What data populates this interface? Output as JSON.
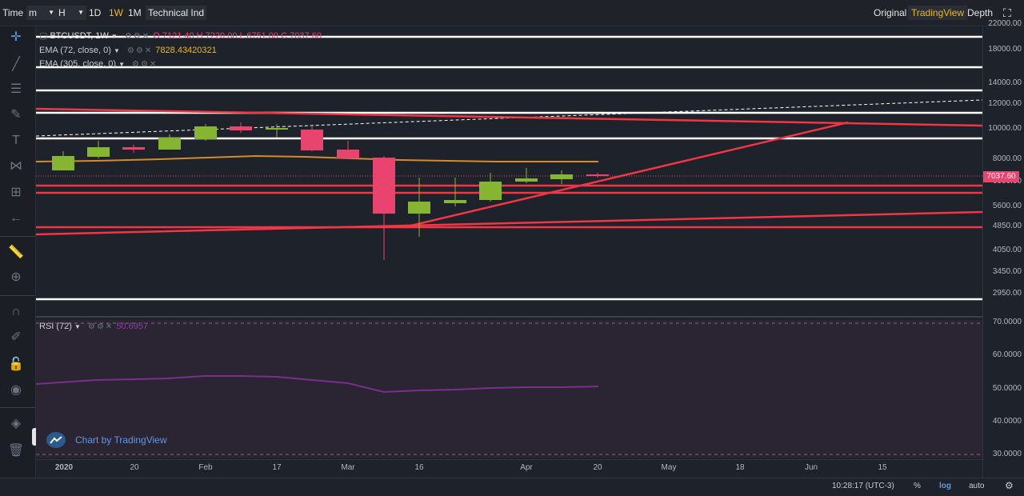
{
  "toolbar": {
    "time_label": "Time",
    "minute_label": "m",
    "hour_label": "H",
    "day_label": "1D",
    "week_label": "1W",
    "month_label": "1M",
    "indicators_label": "Technical Ind",
    "original_label": "Original",
    "tradingview_label": "TradingView",
    "depth_label": "Depth"
  },
  "legend": {
    "symbol": "BTCUSDT, 1W",
    "open": "O 7121.40",
    "high": "H 7220.00",
    "low": "L 6751.00",
    "close": "C 7037.60",
    "ema72_label": "EMA (72, close, 0)",
    "ema72_value": "7828.43420321",
    "ema305_label": "EMA (305, close, 0)",
    "rsi_label": "RSI (72)",
    "rsi_value": "50.6957"
  },
  "price_axis": {
    "labels": [
      "22000.00",
      "18000.00",
      "14000.00",
      "12000.00",
      "10000.00",
      "8000.00",
      "6000.00",
      "5600.00",
      "4850.00",
      "4050.00",
      "3450.00",
      "2950.00"
    ],
    "current_price": "7037.60"
  },
  "rsi_axis": {
    "labels": [
      "70.0000",
      "60.0000",
      "50.0000",
      "40.0000",
      "30.0000"
    ]
  },
  "time_axis": {
    "labels": [
      "2020",
      "20",
      "Feb",
      "17",
      "Mar",
      "16",
      "Apr",
      "20",
      "May",
      "18",
      "Jun",
      "15"
    ]
  },
  "branding": {
    "text": "Chart by TradingView"
  },
  "status": {
    "clock": "10:28:17 (UTC-3)",
    "percent": "%",
    "log": "log",
    "auto": "auto"
  },
  "colors": {
    "up": "#86b532",
    "down": "#e8446e",
    "ema": "#d68a2a",
    "rsi": "#7a2f8c",
    "accent": "#f0b90b",
    "hline_red": "#f23645",
    "hline_white": "#ffffff"
  }
}
